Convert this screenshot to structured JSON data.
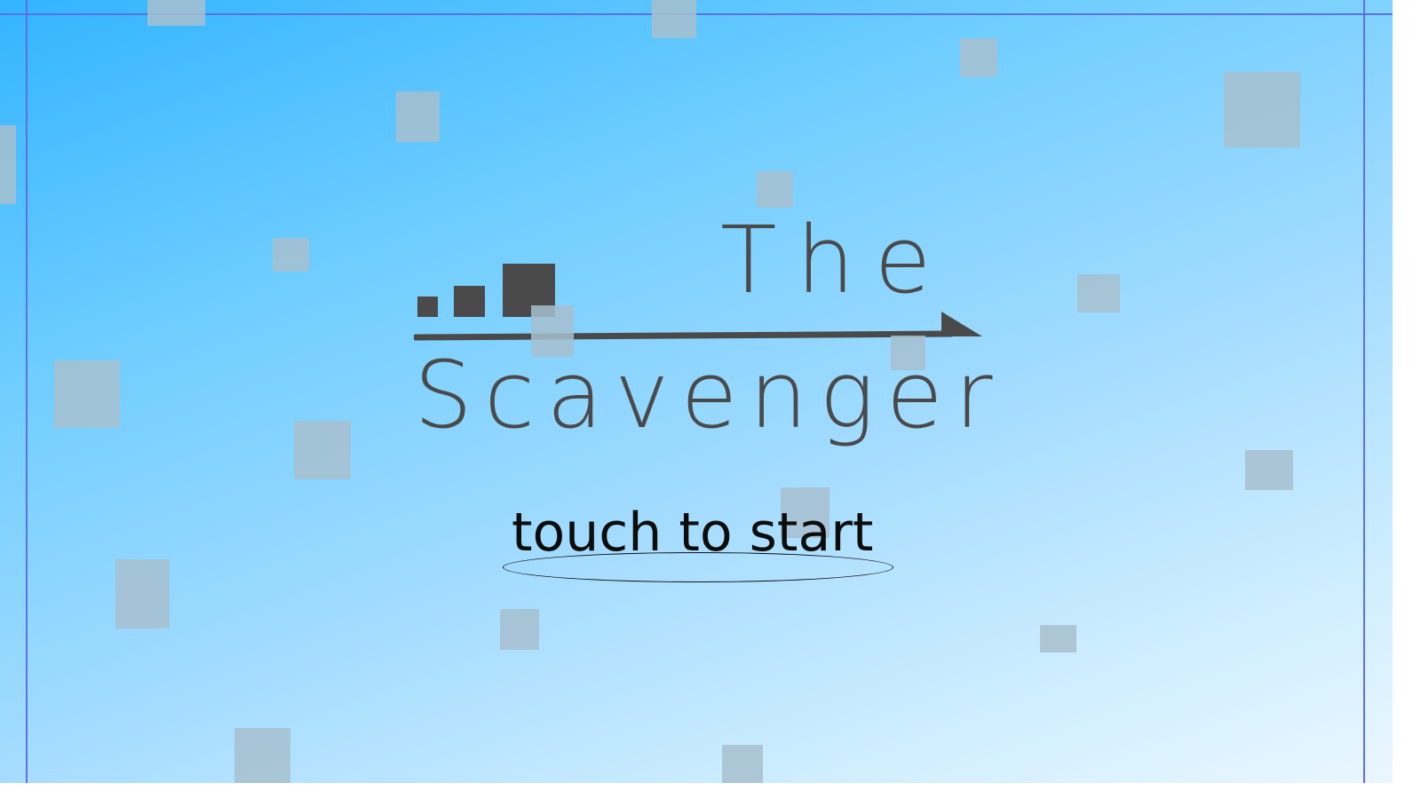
{
  "game": {
    "title_line1": "The",
    "title_line2": "Scavenger",
    "start_prompt": "touch to start"
  },
  "colors": {
    "background_top": "#33b4ff",
    "background_bottom": "#eaf6ff",
    "logo": "#4a4a4a",
    "floating_block": "#a7bfcf",
    "frame_border": "#5b73e0",
    "prompt_text": "#0c0c0c"
  },
  "icons": {
    "logo_mark": "ascending-squares-arrow-icon"
  }
}
